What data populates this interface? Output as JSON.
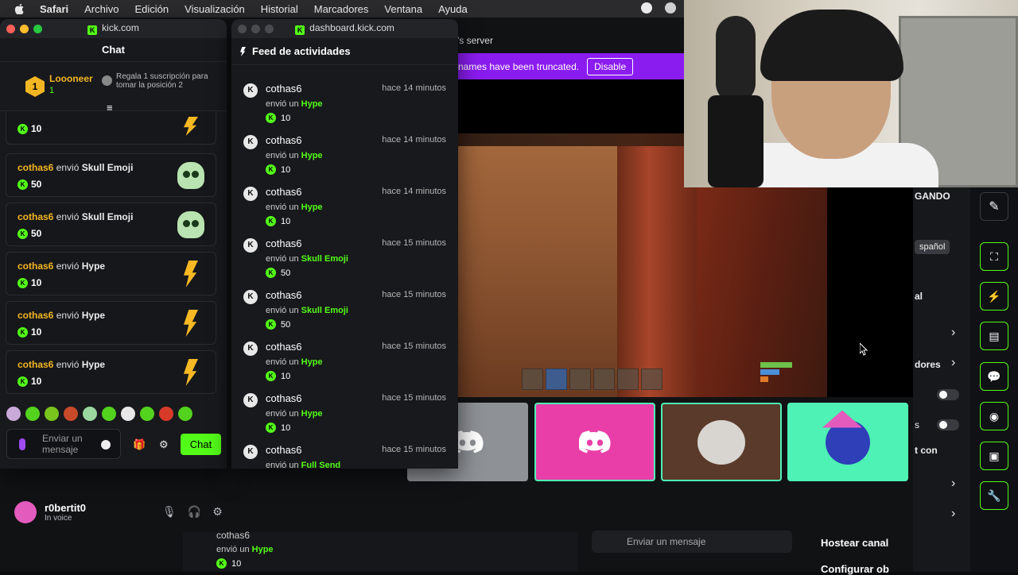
{
  "menubar": {
    "app": "Safari",
    "items": [
      "Archivo",
      "Edición",
      "Visualización",
      "Historial",
      "Marcadores",
      "Ventana",
      "Ayuda"
    ]
  },
  "background": {
    "server": "'s server",
    "banner_text": "names have been truncated.",
    "banner_button": "Disable",
    "side_items": {
      "gando": "GANDO",
      "espanol": "spañol",
      "al": "al",
      "dores": "dores",
      "s": "s",
      "con": "t con"
    },
    "bottom_input": "Enviar un mensaje",
    "hostear": "Hostear canal",
    "configurar": "Configurar ob",
    "bottom_user": "cothas6",
    "bottom_sent": "envió un",
    "bottom_gift": "Hype",
    "bottom_amount": "10",
    "discord_user": "r0bertit0",
    "discord_status": "In voice"
  },
  "chat_window": {
    "title": "kick.com",
    "header": "Chat",
    "pinned": {
      "rank": "1",
      "username": "Loooneer",
      "count": "1",
      "gift_text": "Regala 1 suscripción para tomar la posición 2"
    },
    "top_partial_amount": "10",
    "messages": [
      {
        "user": "cothas6",
        "verb": "envió",
        "gift": "Skull Emoji",
        "amount": "50"
      },
      {
        "user": "cothas6",
        "verb": "envió",
        "gift": "Skull Emoji",
        "amount": "50"
      },
      {
        "user": "cothas6",
        "verb": "envió",
        "gift": "Hype",
        "amount": "10"
      },
      {
        "user": "cothas6",
        "verb": "envió",
        "gift": "Hype",
        "amount": "10"
      },
      {
        "user": "cothas6",
        "verb": "envió",
        "gift": "Hype",
        "amount": "10"
      }
    ],
    "input_placeholder": "Enviar un mensaje",
    "send_label": "Chat"
  },
  "activity_window": {
    "title": "dashboard.kick.com",
    "header": "Feed de actividades",
    "items": [
      {
        "user": "cothas6",
        "time": "hace 14 minutos",
        "sent": "envió un",
        "gift": "Hype",
        "amount": "10"
      },
      {
        "user": "cothas6",
        "time": "hace 14 minutos",
        "sent": "envió un",
        "gift": "Hype",
        "amount": "10"
      },
      {
        "user": "cothas6",
        "time": "hace 14 minutos",
        "sent": "envió un",
        "gift": "Hype",
        "amount": "10"
      },
      {
        "user": "cothas6",
        "time": "hace 15 minutos",
        "sent": "envió un",
        "gift": "Skull Emoji",
        "amount": "50"
      },
      {
        "user": "cothas6",
        "time": "hace 15 minutos",
        "sent": "envió un",
        "gift": "Skull Emoji",
        "amount": "50"
      },
      {
        "user": "cothas6",
        "time": "hace 15 minutos",
        "sent": "envió un",
        "gift": "Hype",
        "amount": "10"
      },
      {
        "user": "cothas6",
        "time": "hace 15 minutos",
        "sent": "envió un",
        "gift": "Hype",
        "amount": "10"
      },
      {
        "user": "cothas6",
        "time": "hace 15 minutos",
        "sent": "envió un",
        "gift": "Full Send",
        "amount": ""
      }
    ]
  },
  "colors": {
    "kick_green": "#53fc18",
    "gold": "#f3b623",
    "banner_purple": "#8b1cf0",
    "discord_pink": "#e93ea8",
    "discord_teal": "#4ef2b4"
  }
}
